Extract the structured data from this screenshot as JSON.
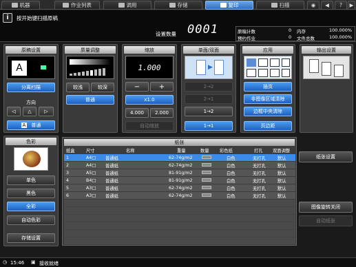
{
  "tabs": [
    {
      "label": "机器",
      "icon": "machine-icon"
    },
    {
      "label": "作业列表",
      "icon": "job-list-icon"
    },
    {
      "label": "调用",
      "icon": "recall-icon"
    },
    {
      "label": "存储",
      "icon": "store-icon"
    },
    {
      "label": "复印",
      "icon": "copy-icon"
    },
    {
      "label": "扫描",
      "icon": "scan-icon"
    }
  ],
  "message": "按开始键扫描原稿",
  "copy_count_label": "设置数量",
  "copy_count": "0001",
  "stats": {
    "original_count_label": "原稿计数",
    "original_count": "0",
    "memory_label": "内存",
    "memory": "100.000%",
    "reserved_jobs_label": "预约作业",
    "reserved_jobs": "0",
    "file_total_label": "文件总数",
    "file_total": "100.000%"
  },
  "original": {
    "title": "原稿设置",
    "separate_scan": "分离扫描",
    "direction_label": "方向",
    "normal": "普通"
  },
  "quality": {
    "title": "质量调整",
    "lighter": "较浅",
    "darker": "较深",
    "normal": "普通"
  },
  "zoom": {
    "title": "缩放",
    "value": "1.000",
    "minus": "−",
    "plus": "+",
    "x1": "x1.0",
    "preset1": "4.000",
    "preset2": "2.000",
    "auto": "自动缩放"
  },
  "duplex": {
    "title": "单面/双面",
    "opt1": "2→2",
    "opt2": "2→1",
    "opt3": "1→2",
    "opt4": "1→1"
  },
  "apply": {
    "title": "应用",
    "insert": "插页",
    "non_image_erase": "非图像区域清除",
    "frame_erase": "边框中央清除",
    "margin": "页边距"
  },
  "output": {
    "title": "输出设置"
  },
  "color": {
    "title": "色彩",
    "single": "单色",
    "black": "黑色",
    "full": "全彩",
    "auto": "自动色彩"
  },
  "store_settings": "存储设置",
  "paper": {
    "title": "纸张",
    "headers": [
      "纸盒",
      "尺寸",
      "名称",
      "重量",
      "数量",
      "彩色纸",
      "打孔",
      "双面调整"
    ],
    "rows": [
      {
        "tray": "1",
        "size": "A4□",
        "name": "普通纸",
        "weight": "62-74g/m2",
        "color": "白色",
        "punch": "无打孔",
        "duplex": "默认"
      },
      {
        "tray": "2",
        "size": "A4□",
        "name": "普通纸",
        "weight": "62-74g/m2",
        "color": "白色",
        "punch": "无打孔",
        "duplex": "默认"
      },
      {
        "tray": "3",
        "size": "A5□",
        "name": "普通纸",
        "weight": "81-91g/m2",
        "color": "白色",
        "punch": "无打孔",
        "duplex": "默认"
      },
      {
        "tray": "4",
        "size": "B4□",
        "name": "普通纸",
        "weight": "81-91g/m2",
        "color": "白色",
        "punch": "无打孔",
        "duplex": "默认"
      },
      {
        "tray": "5",
        "size": "A3□",
        "name": "普通纸",
        "weight": "62-74g/m2",
        "color": "白色",
        "punch": "无打孔",
        "duplex": "默认"
      },
      {
        "tray": "6",
        "size": "A3□",
        "name": "普通纸",
        "weight": "62-74g/m2",
        "color": "白色",
        "punch": "无打孔",
        "duplex": "默认"
      }
    ],
    "settings_button": "纸张设置",
    "rotate_off": "图像旋转关闭",
    "auto_paper": "自动纸张"
  },
  "status": {
    "time": "15:46",
    "text": "接收就绪"
  }
}
